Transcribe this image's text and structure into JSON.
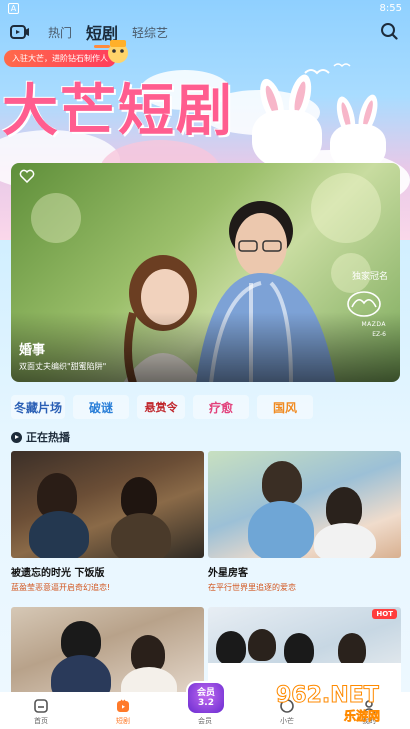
{
  "statusbar": {
    "left_icon": "A",
    "time": "8:55"
  },
  "topnav": {
    "tabs": [
      {
        "label": "热门"
      },
      {
        "label": "短剧"
      },
      {
        "label": "轻综艺"
      }
    ],
    "active_tab": "短剧"
  },
  "hero": {
    "promo_chip": "入驻大芒，进阶钻石制作人",
    "title": "大芒短剧"
  },
  "banner": {
    "title": "婚事",
    "subtitle": "双面丈夫编织\"甜蜜陷阱\"",
    "sponsor_label": "独家冠名",
    "sponsor_brand": "MAZDA",
    "sponsor_model": "EZ-6"
  },
  "categories": [
    {
      "label": "冬藏片场"
    },
    {
      "label": "破谜"
    },
    {
      "label": "悬赏令"
    },
    {
      "label": "疗愈"
    },
    {
      "label": "国风"
    }
  ],
  "section": {
    "title": "正在热播"
  },
  "cards": [
    {
      "name": "被遗忘的时光 下饭版",
      "desc": "蓝盈莹恶意逼开启奇幻追恋!"
    },
    {
      "name": "外星房客",
      "desc": "在平行世界里追逐的爱恋"
    },
    {
      "name": "",
      "desc": ""
    },
    {
      "name": "",
      "desc": "",
      "badge": "HOT"
    }
  ],
  "bottomnav": {
    "items": [
      {
        "label": "首页"
      },
      {
        "label": "短剧"
      },
      {
        "label": "会员"
      },
      {
        "label": "小芒"
      },
      {
        "label": "我的"
      }
    ],
    "vip_badge": "会员\n3.2"
  },
  "watermark": {
    "number": "962.NET",
    "text": "乐游网"
  },
  "colors": {
    "accent": "#ff7a2a",
    "hero_title": "#ff5d8f",
    "desc_text": "#d2541d"
  }
}
